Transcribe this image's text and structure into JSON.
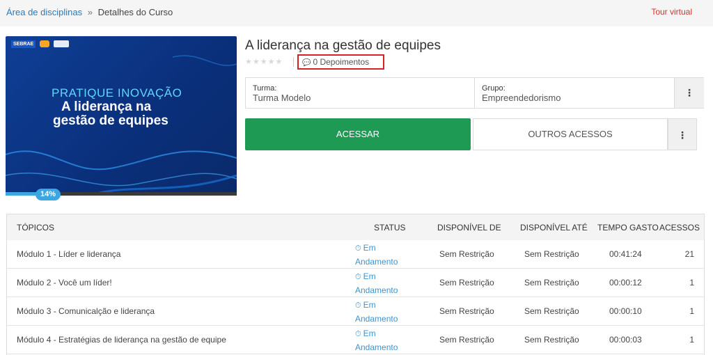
{
  "breadcrumb": {
    "parent": "Área de disciplinas",
    "separator": "»",
    "current": "Detalhes do Curso"
  },
  "tour_label": "Tour virtual",
  "banner": {
    "brand": "SEBRAE",
    "line1": "PRATIQUE INOVAÇÃO",
    "line2": "A liderança na",
    "line3": "gestão de equipes",
    "progress_percent": 14,
    "progress_label": "14%"
  },
  "course": {
    "title": "A liderança na gestão de equipes",
    "stars": "★★★★★",
    "reviews_icon": "comment-icon",
    "reviews_label": "0 Depoimentos"
  },
  "class_info": {
    "turma_label": "Turma:",
    "turma_value": "Turma Modelo",
    "grupo_label": "Grupo:",
    "grupo_value": "Empreendedorismo",
    "menu_icon": "⋮"
  },
  "actions": {
    "access_label": "ACESSAR",
    "other_label": "OUTROS ACESSOS",
    "menu_icon": "⋮"
  },
  "table": {
    "headers": {
      "topics": "TÓPICOS",
      "status": "STATUS",
      "available_from": "DISPONÍVEL DE",
      "available_until": "DISPONÍVEL ATÉ",
      "time_spent": "TEMPO GASTO",
      "accesses": "ACESSOS"
    },
    "rows": [
      {
        "topic": "Módulo 1 - Líder e liderança",
        "status_l1": "Em",
        "status_l2": "Andamento",
        "from": "Sem Restrição",
        "until": "Sem Restrição",
        "time": "00:41:24",
        "accesses": "21"
      },
      {
        "topic": "Módulo 2 - Você um líder!",
        "status_l1": "Em",
        "status_l2": "Andamento",
        "from": "Sem Restrição",
        "until": "Sem Restrição",
        "time": "00:00:12",
        "accesses": "1"
      },
      {
        "topic": "Módulo 3 - Comunicalção e liderança",
        "status_l1": "Em",
        "status_l2": "Andamento",
        "from": "Sem Restrição",
        "until": "Sem Restrição",
        "time": "00:00:10",
        "accesses": "1"
      },
      {
        "topic": "Módulo 4 - Estratégias de liderança na gestão de equipe",
        "status_l1": "Em",
        "status_l2": "Andamento",
        "from": "Sem Restrição",
        "until": "Sem Restrição",
        "time": "00:00:03",
        "accesses": "1"
      }
    ]
  },
  "colors": {
    "accent_green": "#1f9a55",
    "link_blue": "#2a7ab8",
    "highlight_red": "#d5202a",
    "status_blue": "#3d93cf",
    "tour_red": "#d0342c"
  }
}
